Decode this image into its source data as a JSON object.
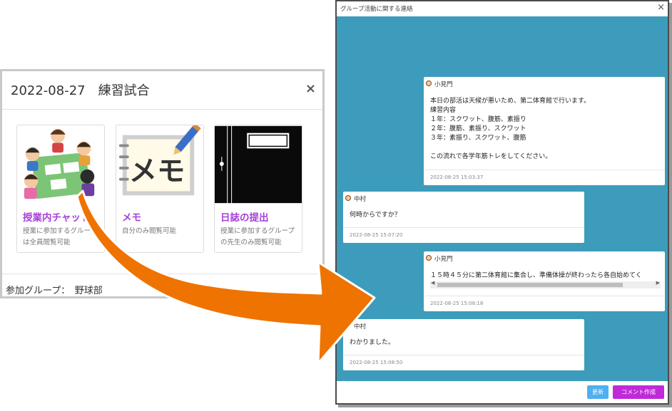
{
  "left_modal": {
    "title": "2022-08-27　練習試合",
    "close": "×",
    "cards": [
      {
        "label": "授業内チャット",
        "desc": "授業に参加するグループは全員閲覧可能"
      },
      {
        "label": "メモ",
        "desc": "自分のみ閲覧可能"
      },
      {
        "label": "日誌の提出",
        "desc": "授業に参加するグループの先生のみ閲覧可能"
      }
    ],
    "footer": "参加グループ：　野球部"
  },
  "window": {
    "title": "グループ活動に関する連絡",
    "close": "×",
    "messages": [
      {
        "author": "小見門",
        "body": "本日の部活は天候が悪いため、第二体育館で行います。\n練習内容\n１年：スクワット、腹筋、素振り\n２年：腹筋、素振り、スクワット\n３年：素振り、スクワット、腹筋\n\nこの流れで各学年筋トレをしてください。",
        "time": "2022-08-25 15:03:37"
      },
      {
        "author": "中村",
        "body": "何時からですか？",
        "time": "2022-08-25 15:07:20"
      },
      {
        "author": "小見門",
        "body": "１５時４５分に第二体育館に集合し、準備体操が終わったら各自始めてく",
        "time": "2022-08-25 15:08:18"
      },
      {
        "author": "中村",
        "body": "わかりました。",
        "time": "2022-08-25 15:08:50"
      }
    ],
    "buttons": {
      "update": "更新",
      "comment": "コメント作成"
    }
  },
  "colors": {
    "chat_bg": "#3d9cbb",
    "accent_purple": "#a63fd8",
    "comment_button": "#c02ad8",
    "update_button": "#4fb0f0",
    "arrow": "#ee7300"
  },
  "icons": [
    "scroll-left-arrow-icon",
    "scroll-right-arrow-icon",
    "user-avatar-icon",
    "close-icon",
    "orange-curved-arrow"
  ]
}
